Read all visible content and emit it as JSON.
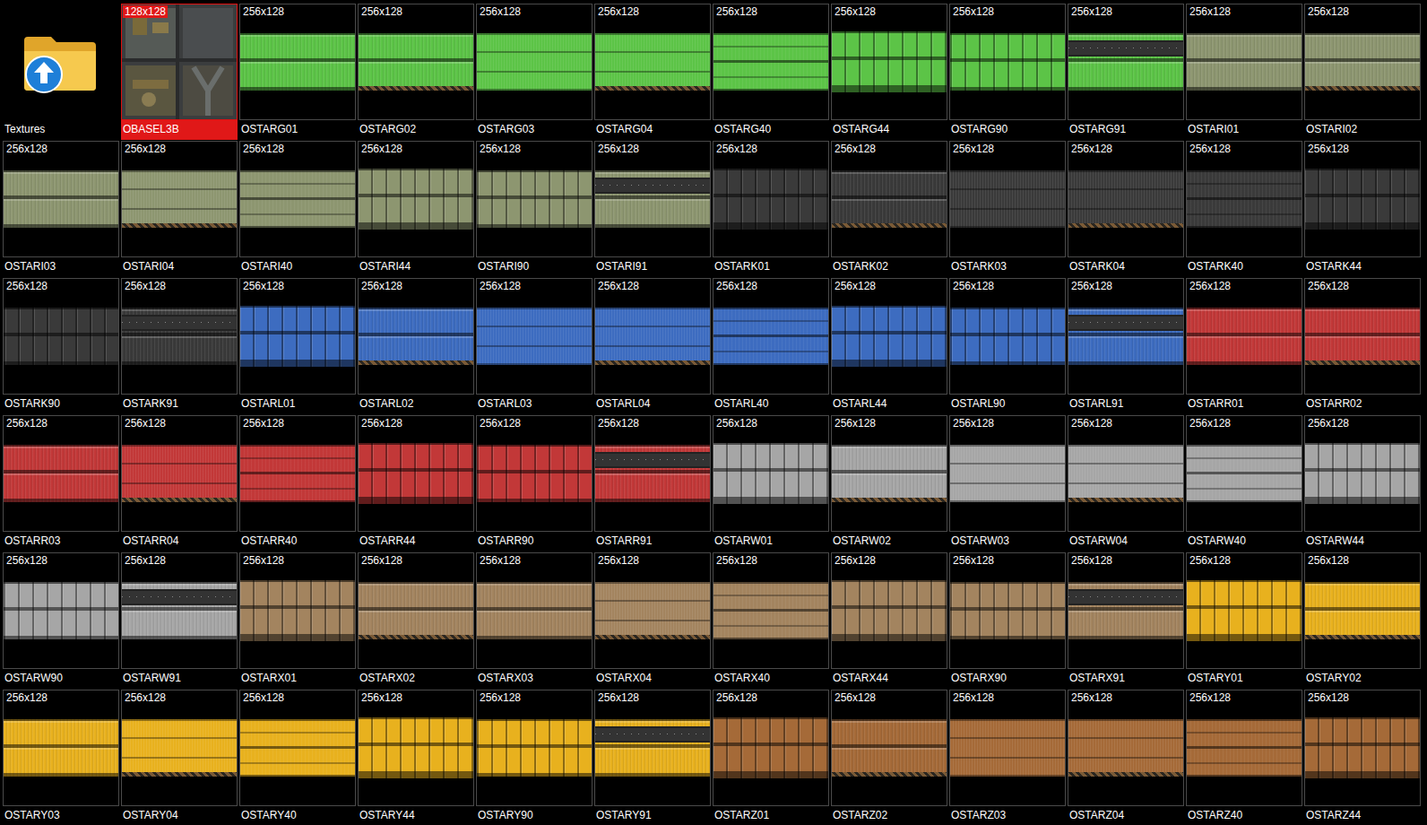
{
  "browser": {
    "items": [
      {
        "name": "Textures",
        "kind": "folder",
        "selected": false
      },
      {
        "name": "OBASEL3B",
        "size": "128x128",
        "kind": "tech",
        "selected": true
      },
      {
        "name": "OSTARG01",
        "size": "256x128",
        "kind": "bands",
        "selected": false,
        "color": "#5cc447"
      },
      {
        "name": "OSTARG02",
        "size": "256x128",
        "kind": "hazard",
        "selected": false,
        "color": "#5cc447"
      },
      {
        "name": "OSTARG03",
        "size": "256x128",
        "kind": "plain",
        "selected": false,
        "color": "#5cc447"
      },
      {
        "name": "OSTARG04",
        "size": "256x128",
        "kind": "plainhazard",
        "selected": false,
        "color": "#5cc447"
      },
      {
        "name": "OSTARG40",
        "size": "256x128",
        "kind": "panel",
        "selected": false,
        "color": "#5cc447"
      },
      {
        "name": "OSTARG44",
        "size": "256x128",
        "kind": "grid",
        "selected": false,
        "color": "#5cc447"
      },
      {
        "name": "OSTARG90",
        "size": "256x128",
        "kind": "mixed",
        "selected": false,
        "color": "#5cc447"
      },
      {
        "name": "OSTARG91",
        "size": "256x128",
        "kind": "stripe",
        "selected": false,
        "color": "#5cc447"
      },
      {
        "name": "OSTARI01",
        "size": "256x128",
        "kind": "bands",
        "selected": false,
        "color": "#8d9670"
      },
      {
        "name": "OSTARI02",
        "size": "256x128",
        "kind": "hazard",
        "selected": false,
        "color": "#8d9670"
      },
      {
        "name": "OSTARI03",
        "size": "256x128",
        "kind": "bands",
        "selected": false,
        "color": "#8d9670"
      },
      {
        "name": "OSTARI04",
        "size": "256x128",
        "kind": "plainhazard",
        "selected": false,
        "color": "#8d9670"
      },
      {
        "name": "OSTARI40",
        "size": "256x128",
        "kind": "panel",
        "selected": false,
        "color": "#8d9670"
      },
      {
        "name": "OSTARI44",
        "size": "256x128",
        "kind": "grid",
        "selected": false,
        "color": "#8d9670"
      },
      {
        "name": "OSTARI90",
        "size": "256x128",
        "kind": "mixed",
        "selected": false,
        "color": "#8d9670"
      },
      {
        "name": "OSTARI91",
        "size": "256x128",
        "kind": "stripe",
        "selected": false,
        "color": "#8d9670"
      },
      {
        "name": "OSTARK01",
        "size": "256x128",
        "kind": "grid",
        "selected": false,
        "color": "#3a3a3a"
      },
      {
        "name": "OSTARK02",
        "size": "256x128",
        "kind": "hazard",
        "selected": false,
        "color": "#3a3a3a"
      },
      {
        "name": "OSTARK03",
        "size": "256x128",
        "kind": "plain",
        "selected": false,
        "color": "#3a3a3a"
      },
      {
        "name": "OSTARK04",
        "size": "256x128",
        "kind": "plainhazard",
        "selected": false,
        "color": "#3a3a3a"
      },
      {
        "name": "OSTARK40",
        "size": "256x128",
        "kind": "panel",
        "selected": false,
        "color": "#3a3a3a"
      },
      {
        "name": "OSTARK44",
        "size": "256x128",
        "kind": "grid",
        "selected": false,
        "color": "#3a3a3a"
      },
      {
        "name": "OSTARK90",
        "size": "256x128",
        "kind": "mixed",
        "selected": false,
        "color": "#3a3a3a"
      },
      {
        "name": "OSTARK91",
        "size": "256x128",
        "kind": "stripe",
        "selected": false,
        "color": "#3a3a3a"
      },
      {
        "name": "OSTARL01",
        "size": "256x128",
        "kind": "grid",
        "selected": false,
        "color": "#3d6cc0"
      },
      {
        "name": "OSTARL02",
        "size": "256x128",
        "kind": "hazard",
        "selected": false,
        "color": "#3d6cc0"
      },
      {
        "name": "OSTARL03",
        "size": "256x128",
        "kind": "plain",
        "selected": false,
        "color": "#3d6cc0"
      },
      {
        "name": "OSTARL04",
        "size": "256x128",
        "kind": "plainhazard",
        "selected": false,
        "color": "#3d6cc0"
      },
      {
        "name": "OSTARL40",
        "size": "256x128",
        "kind": "panel",
        "selected": false,
        "color": "#3d6cc0"
      },
      {
        "name": "OSTARL44",
        "size": "256x128",
        "kind": "grid",
        "selected": false,
        "color": "#3d6cc0"
      },
      {
        "name": "OSTARL90",
        "size": "256x128",
        "kind": "mixed",
        "selected": false,
        "color": "#3d6cc0"
      },
      {
        "name": "OSTARL91",
        "size": "256x128",
        "kind": "stripe",
        "selected": false,
        "color": "#3d6cc0"
      },
      {
        "name": "OSTARR01",
        "size": "256x128",
        "kind": "bands",
        "selected": false,
        "color": "#c23838"
      },
      {
        "name": "OSTARR02",
        "size": "256x128",
        "kind": "hazard",
        "selected": false,
        "color": "#c23838"
      },
      {
        "name": "OSTARR03",
        "size": "256x128",
        "kind": "bands",
        "selected": false,
        "color": "#c23838"
      },
      {
        "name": "OSTARR04",
        "size": "256x128",
        "kind": "plainhazard",
        "selected": false,
        "color": "#c23838"
      },
      {
        "name": "OSTARR40",
        "size": "256x128",
        "kind": "panel",
        "selected": false,
        "color": "#c23838"
      },
      {
        "name": "OSTARR44",
        "size": "256x128",
        "kind": "grid",
        "selected": false,
        "color": "#c23838"
      },
      {
        "name": "OSTARR90",
        "size": "256x128",
        "kind": "mixed",
        "selected": false,
        "color": "#c23838"
      },
      {
        "name": "OSTARR91",
        "size": "256x128",
        "kind": "stripe",
        "selected": false,
        "color": "#c23838"
      },
      {
        "name": "OSTARW01",
        "size": "256x128",
        "kind": "grid",
        "selected": false,
        "color": "#a6a6a6"
      },
      {
        "name": "OSTARW02",
        "size": "256x128",
        "kind": "hazard",
        "selected": false,
        "color": "#a6a6a6"
      },
      {
        "name": "OSTARW03",
        "size": "256x128",
        "kind": "plain",
        "selected": false,
        "color": "#a6a6a6"
      },
      {
        "name": "OSTARW04",
        "size": "256x128",
        "kind": "plainhazard",
        "selected": false,
        "color": "#a6a6a6"
      },
      {
        "name": "OSTARW40",
        "size": "256x128",
        "kind": "panel",
        "selected": false,
        "color": "#a6a6a6"
      },
      {
        "name": "OSTARW44",
        "size": "256x128",
        "kind": "grid",
        "selected": false,
        "color": "#a6a6a6"
      },
      {
        "name": "OSTARW90",
        "size": "256x128",
        "kind": "mixed",
        "selected": false,
        "color": "#a6a6a6"
      },
      {
        "name": "OSTARW91",
        "size": "256x128",
        "kind": "stripe",
        "selected": false,
        "color": "#a6a6a6"
      },
      {
        "name": "OSTARX01",
        "size": "256x128",
        "kind": "grid",
        "selected": false,
        "color": "#a3845f"
      },
      {
        "name": "OSTARX02",
        "size": "256x128",
        "kind": "hazard",
        "selected": false,
        "color": "#a3845f"
      },
      {
        "name": "OSTARX03",
        "size": "256x128",
        "kind": "bands",
        "selected": false,
        "color": "#a3845f"
      },
      {
        "name": "OSTARX04",
        "size": "256x128",
        "kind": "plainhazard",
        "selected": false,
        "color": "#a3845f"
      },
      {
        "name": "OSTARX40",
        "size": "256x128",
        "kind": "panel",
        "selected": false,
        "color": "#a3845f"
      },
      {
        "name": "OSTARX44",
        "size": "256x128",
        "kind": "grid",
        "selected": false,
        "color": "#a3845f"
      },
      {
        "name": "OSTARX90",
        "size": "256x128",
        "kind": "mixed",
        "selected": false,
        "color": "#a3845f"
      },
      {
        "name": "OSTARX91",
        "size": "256x128",
        "kind": "stripe",
        "selected": false,
        "color": "#a3845f"
      },
      {
        "name": "OSTARY01",
        "size": "256x128",
        "kind": "grid",
        "selected": false,
        "color": "#e8b11e"
      },
      {
        "name": "OSTARY02",
        "size": "256x128",
        "kind": "hazard",
        "selected": false,
        "color": "#e8b11e"
      },
      {
        "name": "OSTARY03",
        "size": "256x128",
        "kind": "bands",
        "selected": false,
        "color": "#e8b11e"
      },
      {
        "name": "OSTARY04",
        "size": "256x128",
        "kind": "plainhazard",
        "selected": false,
        "color": "#e8b11e"
      },
      {
        "name": "OSTARY40",
        "size": "256x128",
        "kind": "panel",
        "selected": false,
        "color": "#e8b11e"
      },
      {
        "name": "OSTARY44",
        "size": "256x128",
        "kind": "grid",
        "selected": false,
        "color": "#e8b11e"
      },
      {
        "name": "OSTARY90",
        "size": "256x128",
        "kind": "mixed",
        "selected": false,
        "color": "#e8b11e"
      },
      {
        "name": "OSTARY91",
        "size": "256x128",
        "kind": "stripe",
        "selected": false,
        "color": "#e8b11e"
      },
      {
        "name": "OSTARZ01",
        "size": "256x128",
        "kind": "grid",
        "selected": false,
        "color": "#a56a38"
      },
      {
        "name": "OSTARZ02",
        "size": "256x128",
        "kind": "hazard",
        "selected": false,
        "color": "#a56a38"
      },
      {
        "name": "OSTARZ03",
        "size": "256x128",
        "kind": "plain",
        "selected": false,
        "color": "#a56a38"
      },
      {
        "name": "OSTARZ04",
        "size": "256x128",
        "kind": "plainhazard",
        "selected": false,
        "color": "#a56a38"
      },
      {
        "name": "OSTARZ40",
        "size": "256x128",
        "kind": "panel",
        "selected": false,
        "color": "#a56a38"
      },
      {
        "name": "OSTARZ44",
        "size": "256x128",
        "kind": "grid",
        "selected": false,
        "color": "#a56a38"
      }
    ]
  }
}
